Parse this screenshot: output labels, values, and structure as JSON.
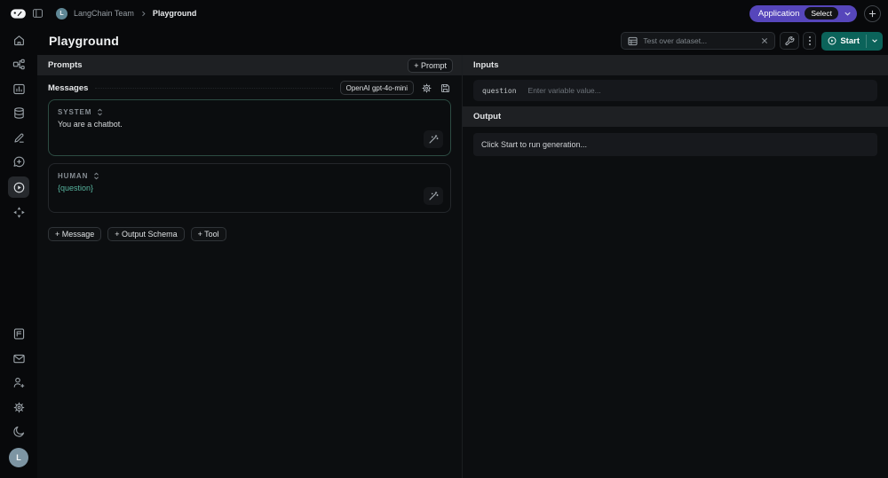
{
  "topbar": {
    "team_avatar_initial": "L",
    "team_name": "LangChain Team",
    "breadcrumb_current": "Playground",
    "application_label": "Application",
    "application_value": "Select"
  },
  "titlebar": {
    "title": "Playground",
    "dataset_input_placeholder": "Test over dataset...",
    "start_label": "Start"
  },
  "prompts_panel": {
    "header": "Prompts",
    "add_prompt_label": "+ Prompt",
    "messages_header": "Messages",
    "model_label": "OpenAI gpt-4o-mini",
    "messages": [
      {
        "role": "SYSTEM",
        "content": "You are a chatbot."
      },
      {
        "role": "HUMAN",
        "content": "{question}"
      }
    ],
    "add_message_label": "+ Message",
    "add_output_schema_label": "+ Output Schema",
    "add_tool_label": "+ Tool"
  },
  "io_panel": {
    "inputs_header": "Inputs",
    "variables": [
      {
        "name": "question",
        "placeholder": "Enter variable value..."
      }
    ],
    "output_header": "Output",
    "output_placeholder": "Click Start to run generation..."
  },
  "user": {
    "avatar_initial": "L"
  },
  "colors": {
    "accent_purple": "#5646bb",
    "accent_green": "#0b635a",
    "variable_teal": "#57b49e",
    "header_bg": "#1e2023",
    "panel_bg": "#0c0e10",
    "app_bg": "#08090b"
  }
}
